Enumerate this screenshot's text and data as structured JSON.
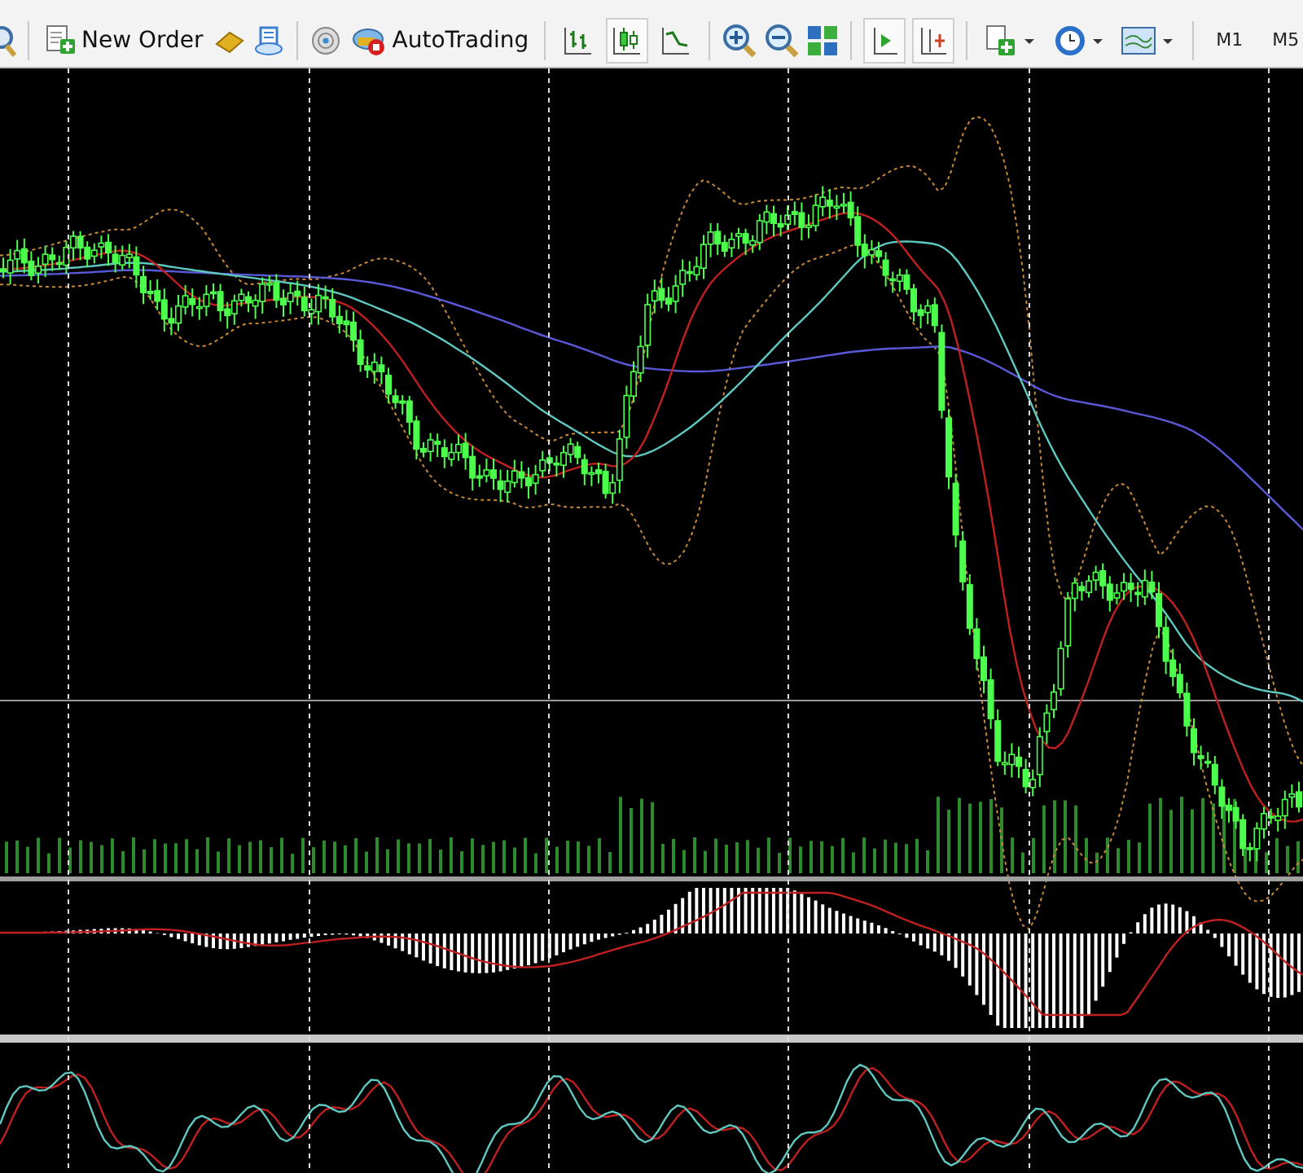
{
  "toolbar": {
    "new_order": {
      "label": "New Order"
    },
    "auto_trading": {
      "label": "AutoTrading"
    },
    "chart_types": [
      {
        "selected": false
      },
      {
        "selected": true
      },
      {
        "selected": false
      }
    ],
    "auto_scroll": {
      "selected": true
    },
    "chart_shift": {
      "selected": true
    },
    "timeframes": [
      {
        "label": "M1",
        "selected": false
      },
      {
        "label": "M5",
        "selected": false
      }
    ]
  }
}
